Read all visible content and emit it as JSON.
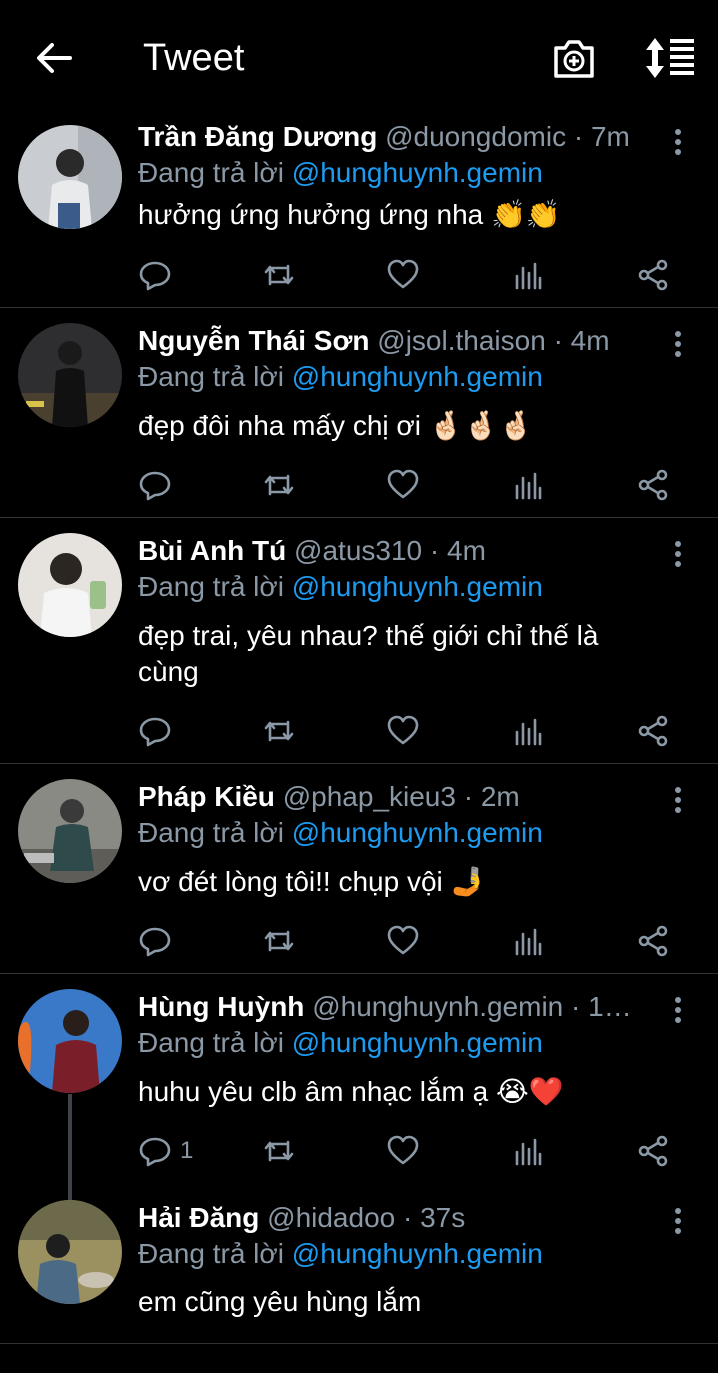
{
  "header": {
    "title": "Tweet",
    "back_icon": "arrow-left-icon",
    "camera_icon": "camera-plus-icon",
    "sort_icon": "sort-icon"
  },
  "colors": {
    "background": "#000000",
    "muted": "#8b98a5",
    "link": "#1d9bf0",
    "divider": "#2f3336"
  },
  "replies": [
    {
      "name": "Trần Đăng Dương",
      "handle": "@duongdomic",
      "time": "· 7m",
      "replying_prefix": "Đang trả lời",
      "replying_to": "@hunghuynh.gemin",
      "text": "hưởng ứng hưởng ứng nha 👏👏",
      "reply_count": ""
    },
    {
      "name": "Nguyễn Thái Sơn",
      "handle": "@jsol.thaison",
      "time": "· 4m",
      "replying_prefix": "Đang trả lời",
      "replying_to": "@hunghuynh.gemin",
      "text": "đẹp đôi nha mấy chị ơi 🤞🏻🤞🏻🤞🏻",
      "reply_count": ""
    },
    {
      "name": "Bùi Anh Tú",
      "handle": "@atus310",
      "time": "· 4m",
      "replying_prefix": "Đang trả lời",
      "replying_to": "@hunghuynh.gemin",
      "text": "đẹp trai, yêu nhau? thế giới chỉ thế là cùng",
      "reply_count": ""
    },
    {
      "name": "Pháp Kiều",
      "handle": "@phap_kieu3",
      "time": "· 2m",
      "replying_prefix": "Đang trả lời",
      "replying_to": "@hunghuynh.gemin",
      "text": "vơ đét lòng tôi!! chụp vội 🤳",
      "reply_count": ""
    },
    {
      "name": "Hùng Huỳnh",
      "handle": "@hunghuynh.gemin",
      "time": "· 1…",
      "replying_prefix": "Đang trả lời",
      "replying_to": "@hunghuynh.gemin",
      "text": "huhu yêu clb âm nhạc lắm ạ 😭❤️",
      "reply_count": "1"
    },
    {
      "name": "Hải Đăng",
      "handle": "@hidadoo",
      "time": "· 37s",
      "replying_prefix": "Đang trả lời",
      "replying_to": "@hunghuynh.gemin",
      "text": "em cũng yêu hùng lắm",
      "reply_count": ""
    }
  ]
}
